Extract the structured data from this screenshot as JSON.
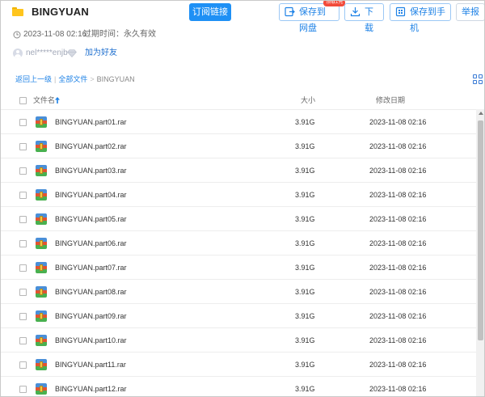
{
  "header": {
    "title": "BINGYUAN",
    "subscribe_label": "订阅链接",
    "save_to_netdisk_label": "保存到网盘",
    "badge_label": "领取1元",
    "download_label": "下载",
    "save_to_phone_label": "保存到手机",
    "report_label": "举报",
    "primary_color": "#1e90f5"
  },
  "meta": {
    "share_time": "2023-11-08 02:16",
    "expiry": "过期时间：永久有效"
  },
  "user": {
    "name": "nel*****enjb",
    "add_friend_label": "加为好友"
  },
  "breadcrumb": {
    "back": "返回上一级",
    "all_files": "全部文件",
    "current": "BINGYUAN"
  },
  "table": {
    "columns": {
      "name": "文件名",
      "size": "大小",
      "date": "修改日期"
    },
    "rows": [
      {
        "name": "BINGYUAN.part01.rar",
        "size": "3.91G",
        "date": "2023-11-08 02:16"
      },
      {
        "name": "BINGYUAN.part02.rar",
        "size": "3.91G",
        "date": "2023-11-08 02:16"
      },
      {
        "name": "BINGYUAN.part03.rar",
        "size": "3.91G",
        "date": "2023-11-08 02:16"
      },
      {
        "name": "BINGYUAN.part04.rar",
        "size": "3.91G",
        "date": "2023-11-08 02:16"
      },
      {
        "name": "BINGYUAN.part05.rar",
        "size": "3.91G",
        "date": "2023-11-08 02:16"
      },
      {
        "name": "BINGYUAN.part06.rar",
        "size": "3.91G",
        "date": "2023-11-08 02:16"
      },
      {
        "name": "BINGYUAN.part07.rar",
        "size": "3.91G",
        "date": "2023-11-08 02:16"
      },
      {
        "name": "BINGYUAN.part08.rar",
        "size": "3.91G",
        "date": "2023-11-08 02:16"
      },
      {
        "name": "BINGYUAN.part09.rar",
        "size": "3.91G",
        "date": "2023-11-08 02:16"
      },
      {
        "name": "BINGYUAN.part10.rar",
        "size": "3.91G",
        "date": "2023-11-08 02:16"
      },
      {
        "name": "BINGYUAN.part11.rar",
        "size": "3.91G",
        "date": "2023-11-08 02:16"
      },
      {
        "name": "BINGYUAN.part12.rar",
        "size": "3.91G",
        "date": "2023-11-08 02:16"
      }
    ]
  },
  "icons": {
    "folder": "folder-icon",
    "file": "rar-archive-icon",
    "view_toggle": "grid-view-icon"
  }
}
